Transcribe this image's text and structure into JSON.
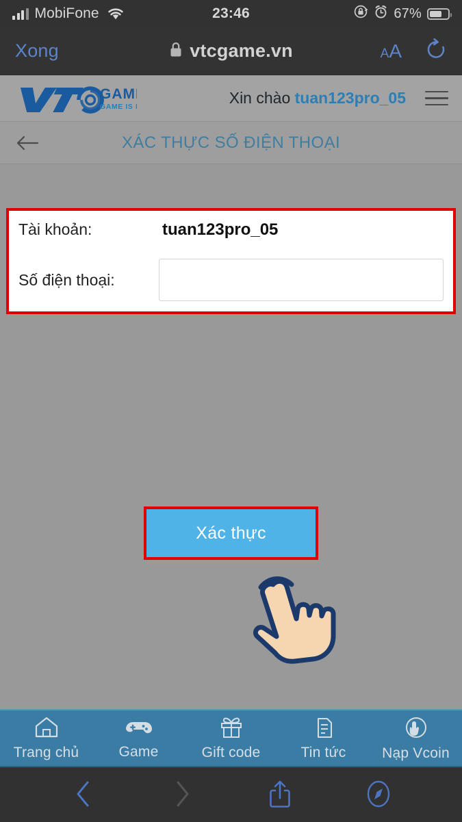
{
  "status_bar": {
    "carrier": "MobiFone",
    "time": "23:46",
    "battery_percent": "67%",
    "icons": [
      "signal-bars-icon",
      "wifi-icon",
      "rotation-lock-icon",
      "alarm-clock-icon",
      "battery-icon"
    ]
  },
  "safari_top": {
    "done_label": "Xong",
    "url": "vtcgame.vn",
    "lock_icon": "lock-icon",
    "text_size_small": "A",
    "text_size_large": "A",
    "reload_icon": "reload-icon"
  },
  "site_header": {
    "logo_primary": "VTC",
    "logo_secondary": "GAME",
    "logo_tagline": "GAME IS LIFE",
    "greeting_prefix": "Xin chào",
    "username": "tuan123pro_05",
    "menu_icon": "hamburger-menu-icon"
  },
  "title_bar": {
    "back_icon": "back-arrow-icon",
    "title": "XÁC THỰC SỐ ĐIỆN THOẠI"
  },
  "form": {
    "account_label": "Tài khoản:",
    "account_value": "tuan123pro_05",
    "phone_label": "Số điện thoại:",
    "phone_value": "",
    "phone_placeholder": "",
    "submit_label": "Xác thực"
  },
  "annotations": {
    "highlight_color": "#e00000",
    "cursor_icon": "tap-hand-cursor-icon"
  },
  "site_nav": {
    "items": [
      {
        "label": "Trang chủ",
        "icon": "home-icon"
      },
      {
        "label": "Game",
        "icon": "gamepad-icon"
      },
      {
        "label": "Gift code",
        "icon": "gift-icon"
      },
      {
        "label": "Tin tức",
        "icon": "news-icon"
      },
      {
        "label": "Nạp Vcoin",
        "icon": "hand-coin-icon"
      }
    ]
  },
  "safari_toolbar": {
    "back_icon": "chevron-left-icon",
    "forward_icon": "chevron-right-icon",
    "share_icon": "share-icon",
    "bookmarks_icon": "compass-icon"
  },
  "colors": {
    "accent_blue": "#4fb3e8",
    "nav_blue": "#3b7ca5",
    "link_blue": "#2b7fb5",
    "highlight_red": "#e00000",
    "page_background": "#999999"
  }
}
